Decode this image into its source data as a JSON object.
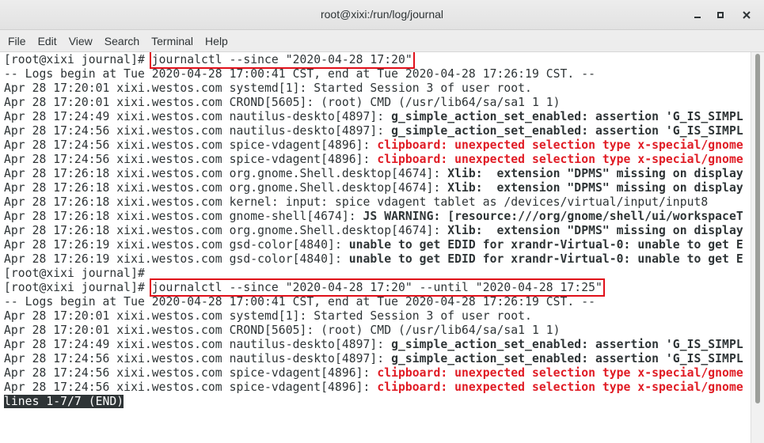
{
  "window": {
    "title": "root@xixi:/run/log/journal"
  },
  "menu": [
    "File",
    "Edit",
    "View",
    "Search",
    "Terminal",
    "Help"
  ],
  "terminal": {
    "lines": [
      [
        {
          "t": "[root@xixi journal]# "
        },
        {
          "t": "journalctl --since \"2020-04-28 17:20\"",
          "hl": true
        }
      ],
      [
        {
          "t": "-- Logs begin at Tue 2020-04-28 17:00:41 CST, end at Tue 2020-04-28 17:26:19 CST. --"
        }
      ],
      [
        {
          "t": "Apr 28 17:20:01 xixi.westos.com systemd[1]: Started Session 3 of user root."
        }
      ],
      [
        {
          "t": "Apr 28 17:20:01 xixi.westos.com CROND[5605]: (root) CMD (/usr/lib64/sa/sa1 1 1)"
        }
      ],
      [
        {
          "t": "Apr 28 17:24:49 xixi.westos.com nautilus-deskto[4897]: "
        },
        {
          "t": "g_simple_action_set_enabled: assertion 'G_IS_SIMPL",
          "s": "b"
        }
      ],
      [
        {
          "t": "Apr 28 17:24:56 xixi.westos.com nautilus-deskto[4897]: "
        },
        {
          "t": "g_simple_action_set_enabled: assertion 'G_IS_SIMPL",
          "s": "b"
        }
      ],
      [
        {
          "t": "Apr 28 17:24:56 xixi.westos.com spice-vdagent[4896]: "
        },
        {
          "t": "clipboard: unexpected selection type x-special/gnome",
          "s": "r"
        }
      ],
      [
        {
          "t": "Apr 28 17:24:56 xixi.westos.com spice-vdagent[4896]: "
        },
        {
          "t": "clipboard: unexpected selection type x-special/gnome",
          "s": "r"
        }
      ],
      [
        {
          "t": "Apr 28 17:26:18 xixi.westos.com org.gnome.Shell.desktop[4674]: "
        },
        {
          "t": "Xlib:  extension \"DPMS\" missing on display",
          "s": "b"
        }
      ],
      [
        {
          "t": "Apr 28 17:26:18 xixi.westos.com org.gnome.Shell.desktop[4674]: "
        },
        {
          "t": "Xlib:  extension \"DPMS\" missing on display",
          "s": "b"
        }
      ],
      [
        {
          "t": "Apr 28 17:26:18 xixi.westos.com kernel: input: spice vdagent tablet as /devices/virtual/input/input8"
        }
      ],
      [
        {
          "t": "Apr 28 17:26:18 xixi.westos.com gnome-shell[4674]: "
        },
        {
          "t": "JS WARNING: [resource:///org/gnome/shell/ui/workspaceT",
          "s": "b"
        }
      ],
      [
        {
          "t": "Apr 28 17:26:18 xixi.westos.com org.gnome.Shell.desktop[4674]: "
        },
        {
          "t": "Xlib:  extension \"DPMS\" missing on display",
          "s": "b"
        }
      ],
      [
        {
          "t": "Apr 28 17:26:19 xixi.westos.com gsd-color[4840]: "
        },
        {
          "t": "unable to get EDID for xrandr-Virtual-0: unable to get E",
          "s": "b"
        }
      ],
      [
        {
          "t": "Apr 28 17:26:19 xixi.westos.com gsd-color[4840]: "
        },
        {
          "t": "unable to get EDID for xrandr-Virtual-0: unable to get E",
          "s": "b"
        }
      ],
      [
        {
          "t": "[root@xixi journal]#"
        }
      ],
      [
        {
          "t": "[root@xixi journal]# "
        },
        {
          "t": "journalctl --since \"2020-04-28 17:20\" --until \"2020-04-28 17:25\"",
          "hl": true
        }
      ],
      [
        {
          "t": "-- Logs begin at Tue 2020-04-28 17:00:41 CST, end at Tue 2020-04-28 17:26:19 CST. --"
        }
      ],
      [
        {
          "t": "Apr 28 17:20:01 xixi.westos.com systemd[1]: Started Session 3 of user root."
        }
      ],
      [
        {
          "t": "Apr 28 17:20:01 xixi.westos.com CROND[5605]: (root) CMD (/usr/lib64/sa/sa1 1 1)"
        }
      ],
      [
        {
          "t": "Apr 28 17:24:49 xixi.westos.com nautilus-deskto[4897]: "
        },
        {
          "t": "g_simple_action_set_enabled: assertion 'G_IS_SIMPL",
          "s": "b"
        }
      ],
      [
        {
          "t": "Apr 28 17:24:56 xixi.westos.com nautilus-deskto[4897]: "
        },
        {
          "t": "g_simple_action_set_enabled: assertion 'G_IS_SIMPL",
          "s": "b"
        }
      ],
      [
        {
          "t": "Apr 28 17:24:56 xixi.westos.com spice-vdagent[4896]: "
        },
        {
          "t": "clipboard: unexpected selection type x-special/gnome",
          "s": "r"
        }
      ],
      [
        {
          "t": "Apr 28 17:24:56 xixi.westos.com spice-vdagent[4896]: "
        },
        {
          "t": "clipboard: unexpected selection type x-special/gnome",
          "s": "r"
        }
      ]
    ],
    "status_line": "lines 1-7/7 (END)"
  },
  "colors": {
    "error_text": "#e01b24",
    "highlight_box": "#e0101a",
    "text": "#2e3436",
    "status_bg": "#2e3436"
  }
}
